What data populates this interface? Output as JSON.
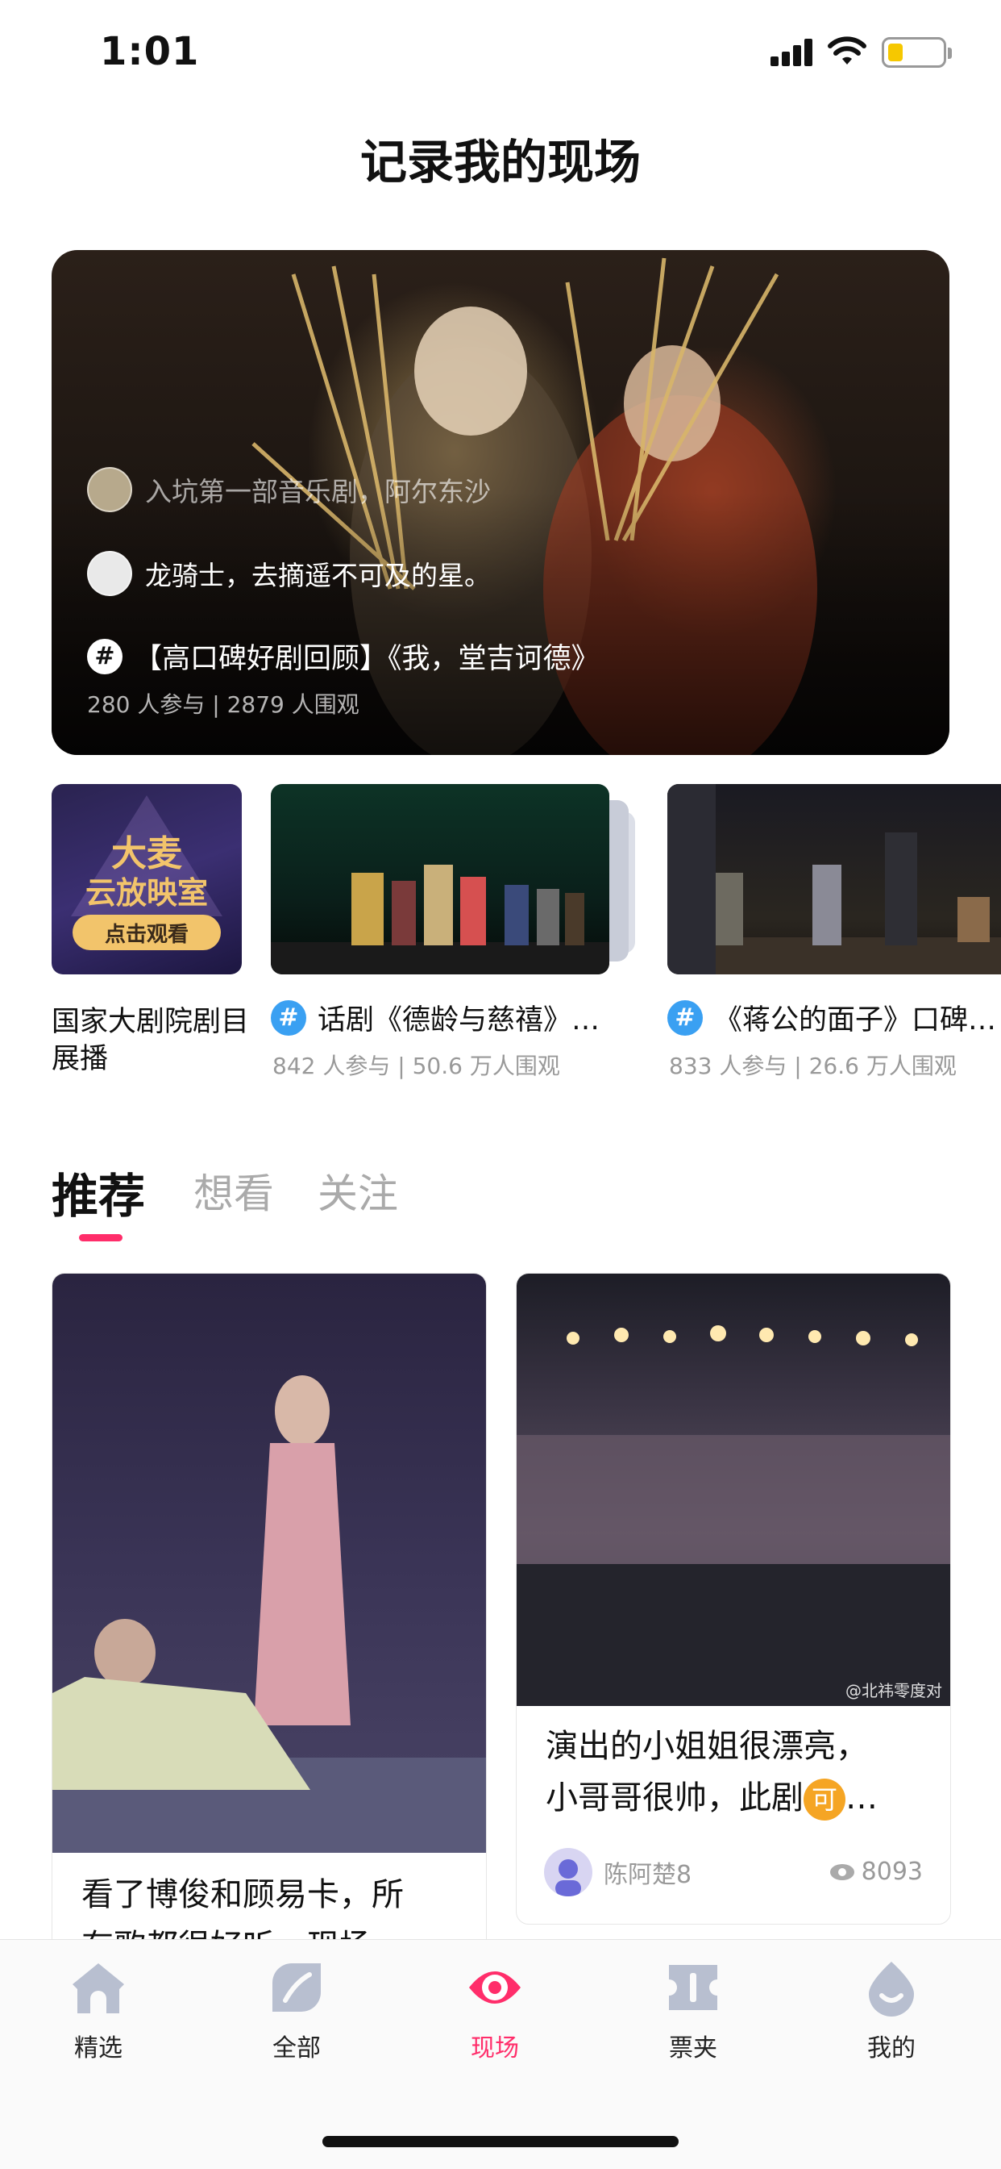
{
  "status_bar": {
    "time": "1:01"
  },
  "page_title": "记录我的现场",
  "hero": {
    "feed": [
      {
        "text": "入坑第一部音乐剧，阿尔东沙"
      },
      {
        "text": "龙骑士，去摘遥不可及的星。"
      }
    ],
    "topic_hash": "#",
    "topic_title": "【高口碑好剧回顾】《我，堂吉诃德》",
    "stats": "280 人参与 | 2879 人围观"
  },
  "topics_row": {
    "promo": {
      "line1": "大麦",
      "line2": "云放映室",
      "button": "点击观看",
      "label": "国家大剧院剧目展播"
    },
    "items": [
      {
        "hash": "#",
        "title": "话剧《德龄与慈禧》…",
        "stats": "842 人参与 | 50.6 万人围观"
      },
      {
        "hash": "#",
        "title": "《蒋公的面子》口碑…",
        "stats": "833 人参与 | 26.6 万人围观"
      }
    ]
  },
  "tabs": [
    {
      "label": "推荐",
      "active": true
    },
    {
      "label": "想看",
      "active": false
    },
    {
      "label": "关注",
      "active": false
    }
  ],
  "feed_cards": [
    {
      "text_line1": "看了博俊和顾易卡，所",
      "text_line2": "有歌都很好听，现场"
    },
    {
      "text_line1": "演出的小姐姐很漂亮，",
      "text_line2": "小哥哥很帅，此剧",
      "badge": "可",
      "ellipsis": "…",
      "author": "陈阿楚8",
      "views": "8093",
      "watermark": "@北祎零度对"
    }
  ],
  "bottom_nav": [
    {
      "label": "精选",
      "icon": "home-icon",
      "active": false
    },
    {
      "label": "全部",
      "icon": "leaf-icon",
      "active": false
    },
    {
      "label": "现场",
      "icon": "live-eye-icon",
      "active": true
    },
    {
      "label": "票夹",
      "icon": "ticket-icon",
      "active": false
    },
    {
      "label": "我的",
      "icon": "profile-drop-icon",
      "active": false
    }
  ],
  "colors": {
    "accent": "#ff2d6a",
    "topic_blue": "#3aa0f2",
    "badge_orange": "#f5a524",
    "muted": "#999999"
  }
}
